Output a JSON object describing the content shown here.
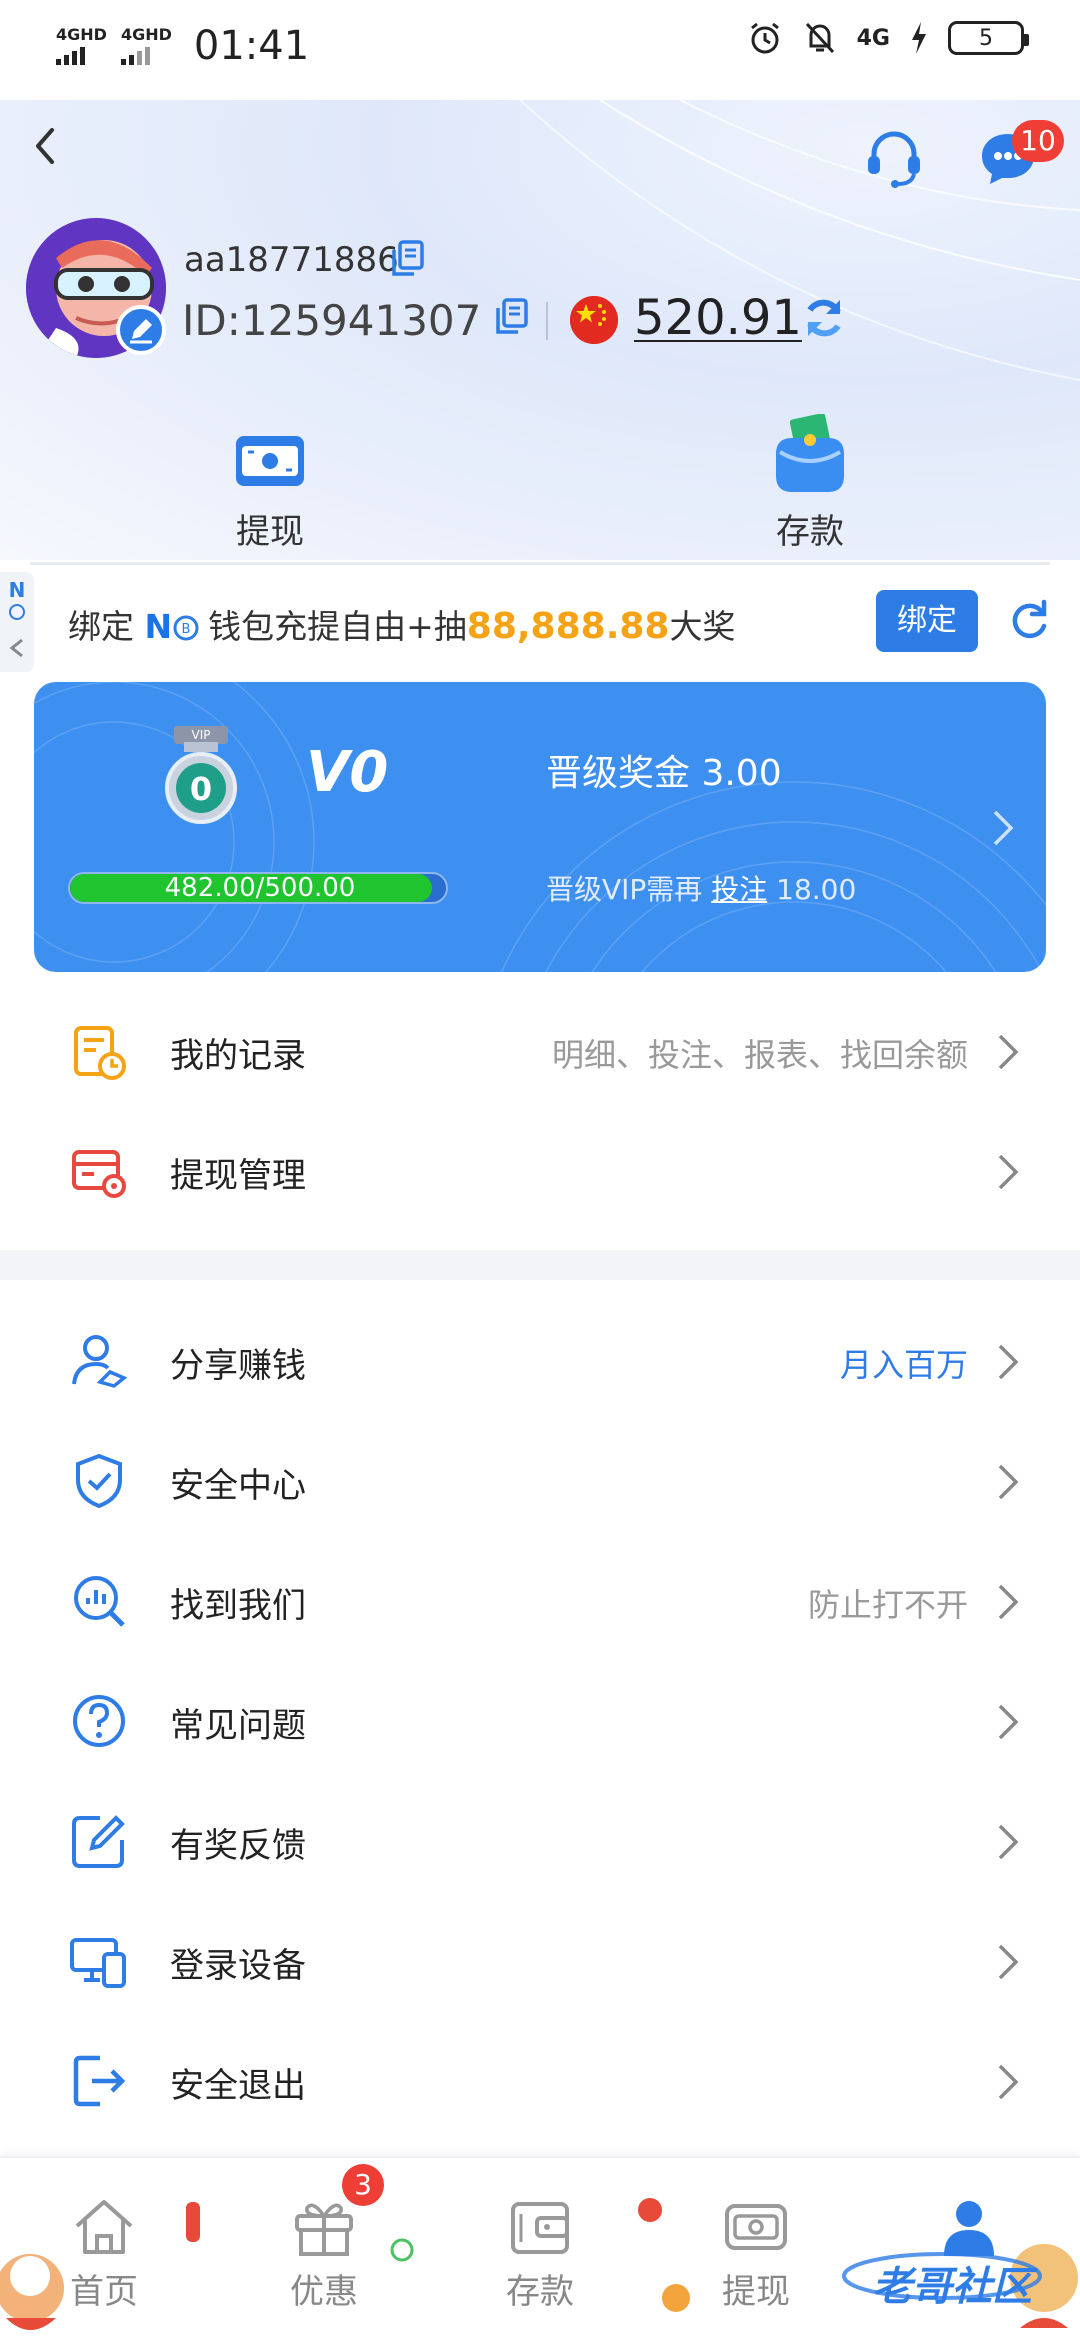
{
  "status_bar": {
    "network1": "4GHD",
    "network2": "4GHD",
    "time": "01:41",
    "network3": "4G",
    "battery": "5"
  },
  "header": {
    "message_badge": "10"
  },
  "profile": {
    "username": "aa18771886",
    "id_text": "ID:125941307",
    "balance": "520.91"
  },
  "quick_actions": {
    "withdraw_label": "提现",
    "deposit_label": "存款"
  },
  "bind_banner": {
    "prefix": "绑定",
    "wallet_name": "N",
    "middle": "钱包充提自由+抽",
    "amount": "88,888.88",
    "suffix": "大奖",
    "button_label": "绑定"
  },
  "vip": {
    "badge_number": "0",
    "level": "V0",
    "bonus_text": "晋级奖金 3.00",
    "progress_text": "482.00/500.00",
    "progress_fraction": 0.964,
    "need_prefix": "晋级VIP需再",
    "need_link": "投注",
    "need_amount": "18.00"
  },
  "menu": {
    "records": {
      "label": "我的记录",
      "hint": "明细、投注、报表、找回余额"
    },
    "withdraw_manage": {
      "label": "提现管理",
      "hint": ""
    },
    "share": {
      "label": "分享赚钱",
      "hint": "月入百万"
    },
    "security": {
      "label": "安全中心",
      "hint": ""
    },
    "find_us": {
      "label": "找到我们",
      "hint": "防止打不开"
    },
    "faq": {
      "label": "常见问题",
      "hint": ""
    },
    "feedback": {
      "label": "有奖反馈",
      "hint": ""
    },
    "devices": {
      "label": "登录设备",
      "hint": ""
    },
    "logout": {
      "label": "安全退出",
      "hint": ""
    }
  },
  "bottom_nav": {
    "home": "首页",
    "promo": "优惠",
    "promo_badge": "3",
    "deposit": "存款",
    "withdraw": "提现",
    "watermark": "老哥社区"
  },
  "colors": {
    "accent": "#2e7ce6",
    "vip_card": "#3d8ff0",
    "progress": "#1fc42f",
    "amount": "#f5a315",
    "badge": "#ef3e36"
  }
}
